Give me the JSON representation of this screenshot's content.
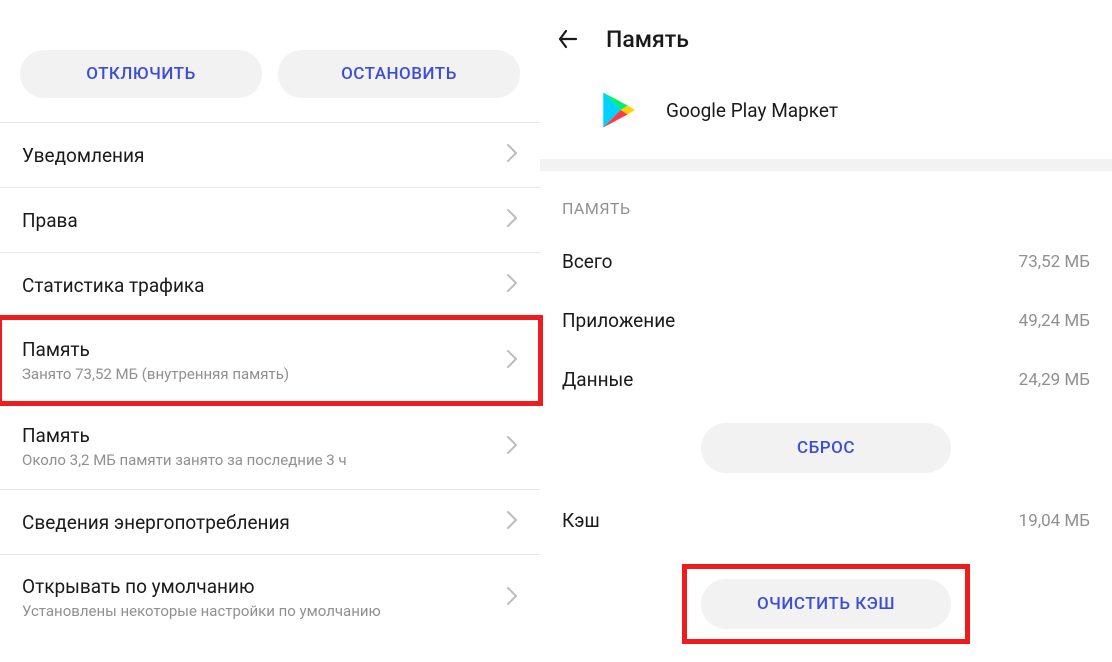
{
  "left": {
    "buttons": {
      "disable": "ОТКЛЮЧИТЬ",
      "stop": "ОСТАНОВИТЬ"
    },
    "items": [
      {
        "title": "Уведомления",
        "sub": ""
      },
      {
        "title": "Права",
        "sub": ""
      },
      {
        "title": "Статистика трафика",
        "sub": ""
      },
      {
        "title": "Память",
        "sub": "Занято 73,52 МБ (внутренняя память)"
      },
      {
        "title": "Память",
        "sub": "Около 3,2 МБ памяти занято за последние 3 ч"
      },
      {
        "title": "Сведения энергопотребления",
        "sub": ""
      },
      {
        "title": "Открывать по умолчанию",
        "sub": "Установлены некоторые настройки по умолчанию"
      }
    ]
  },
  "right": {
    "header": "Память",
    "app_name": "Google Play Маркет",
    "section_label": "ПАМЯТЬ",
    "rows": {
      "total": {
        "key": "Всего",
        "val": "73,52 МБ"
      },
      "app": {
        "key": "Приложение",
        "val": "49,24 МБ"
      },
      "data": {
        "key": "Данные",
        "val": "24,29 МБ"
      },
      "cache": {
        "key": "Кэш",
        "val": "19,04 МБ"
      }
    },
    "buttons": {
      "reset": "СБРОС",
      "clear_cache": "ОЧИСТИТЬ КЭШ"
    }
  }
}
